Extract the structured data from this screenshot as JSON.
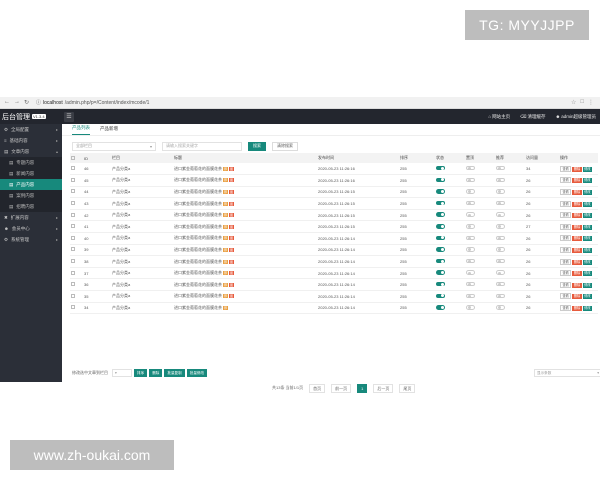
{
  "watermark_top": "TG: MYYJJPP",
  "watermark_bottom": "www.zh-oukai.com",
  "browser": {
    "host": "localhost",
    "path": "/admin.php/p=/Content/index/mcode/1"
  },
  "header": {
    "brand": "后台管理",
    "version": "V1.3.4",
    "right_items": [
      "网站主页",
      "清理缓存",
      "admin超级管理员"
    ]
  },
  "sidebar": [
    {
      "label": "全局配置",
      "type": "item"
    },
    {
      "label": "基础内容",
      "type": "item"
    },
    {
      "label": "文章内容",
      "type": "item"
    },
    {
      "label": "专题内容",
      "type": "sub"
    },
    {
      "label": "新闻内容",
      "type": "sub"
    },
    {
      "label": "产品内容",
      "type": "sub",
      "active": true
    },
    {
      "label": "案例内容",
      "type": "sub"
    },
    {
      "label": "招聘内容",
      "type": "sub"
    },
    {
      "label": "扩展内容",
      "type": "item"
    },
    {
      "label": "会员中心",
      "type": "item"
    },
    {
      "label": "系统管理",
      "type": "item"
    }
  ],
  "tabs": [
    "产品列表",
    "产品新增"
  ],
  "filters": {
    "category_placeholder": "全部栏目",
    "keyword_placeholder": "请输入搜索关键字",
    "search_label": "搜索",
    "clear_label": "清除搜索"
  },
  "table": {
    "headers": [
      "ID",
      "栏目",
      "标题",
      "发布时间",
      "排序",
      "状态",
      "置顶",
      "推荐",
      "访问量",
      "操作"
    ],
    "rows": [
      {
        "id": "46",
        "cat": "产品分类a",
        "title": "进口紫金葡萄花的面膜花茶",
        "date": "2020-05-23 11:26:16",
        "sort": "255",
        "top": false,
        "rec": false,
        "views": "34"
      },
      {
        "id": "45",
        "cat": "产品分类a",
        "title": "进口紫金葡萄花的面膜花茶",
        "date": "2020-05-23 11:26:16",
        "sort": "255",
        "top": false,
        "rec": false,
        "views": "26"
      },
      {
        "id": "44",
        "cat": "产品分类a",
        "title": "进口紫金葡萄花的面膜花茶",
        "date": "2020-05-23 11:26:15",
        "sort": "255",
        "top": false,
        "rec": false,
        "views": "26"
      },
      {
        "id": "43",
        "cat": "产品分类a",
        "title": "进口紫金葡萄花的面膜花茶",
        "date": "2020-05-23 11:26:15",
        "sort": "255",
        "top": false,
        "rec": false,
        "views": "26"
      },
      {
        "id": "42",
        "cat": "产品分类a",
        "title": "进口紫金葡萄花的面膜花茶",
        "date": "2020-05-23 11:26:15",
        "sort": "255",
        "top": false,
        "rec": false,
        "views": "26"
      },
      {
        "id": "41",
        "cat": "产品分类a",
        "title": "进口紫金葡萄花的面膜花茶",
        "date": "2020-05-23 11:26:15",
        "sort": "255",
        "top": false,
        "rec": false,
        "views": "27"
      },
      {
        "id": "40",
        "cat": "产品分类a",
        "title": "进口紫金葡萄花的面膜花茶",
        "date": "2020-05-23 11:26:14",
        "sort": "255",
        "top": false,
        "rec": false,
        "views": "26"
      },
      {
        "id": "39",
        "cat": "产品分类a",
        "title": "进口紫金葡萄花的面膜花茶",
        "date": "2020-05-23 11:26:14",
        "sort": "255",
        "top": false,
        "rec": false,
        "views": "26"
      },
      {
        "id": "38",
        "cat": "产品分类a",
        "title": "进口紫金葡萄花的面膜花茶",
        "date": "2020-05-23 11:26:14",
        "sort": "255",
        "top": false,
        "rec": false,
        "views": "26"
      },
      {
        "id": "37",
        "cat": "产品分类a",
        "title": "进口紫金葡萄花的面膜花茶",
        "date": "2020-05-23 11:26:14",
        "sort": "255",
        "top": false,
        "rec": false,
        "views": "26"
      },
      {
        "id": "36",
        "cat": "产品分类a",
        "title": "进口紫金葡萄花的面膜花茶",
        "date": "2020-05-23 11:26:14",
        "sort": "255",
        "top": false,
        "rec": false,
        "views": "26"
      },
      {
        "id": "35",
        "cat": "产品分类a",
        "title": "进口紫金葡萄花的面膜花茶",
        "date": "2020-05-23 11:26:14",
        "sort": "255",
        "top": false,
        "rec": false,
        "views": "26"
      },
      {
        "id": "34",
        "cat": "产品分类a",
        "title": "进口紫金葡萄花的面膜花茶",
        "date": "2020-05-23 11:26:14",
        "sort": "255",
        "top": false,
        "rec": false,
        "views": "26"
      }
    ],
    "ops": [
      "查看",
      "删除",
      "修改"
    ],
    "tag_labels": [
      "荐",
      "图"
    ]
  },
  "bottom": {
    "label": "修改选中文章到栏目",
    "buttons": [
      "排序",
      "删除",
      "批量复制",
      "批量修改"
    ],
    "right_select": "显示条数"
  },
  "pager": {
    "info": "共13条 当前1/1页",
    "buttons": [
      "首页",
      "前一页",
      "1",
      "后一页",
      "尾页"
    ]
  },
  "colors": {
    "accent": "#17897c",
    "danger": "#e75b3d",
    "warn": "#e9a043",
    "dark": "#23262e"
  }
}
